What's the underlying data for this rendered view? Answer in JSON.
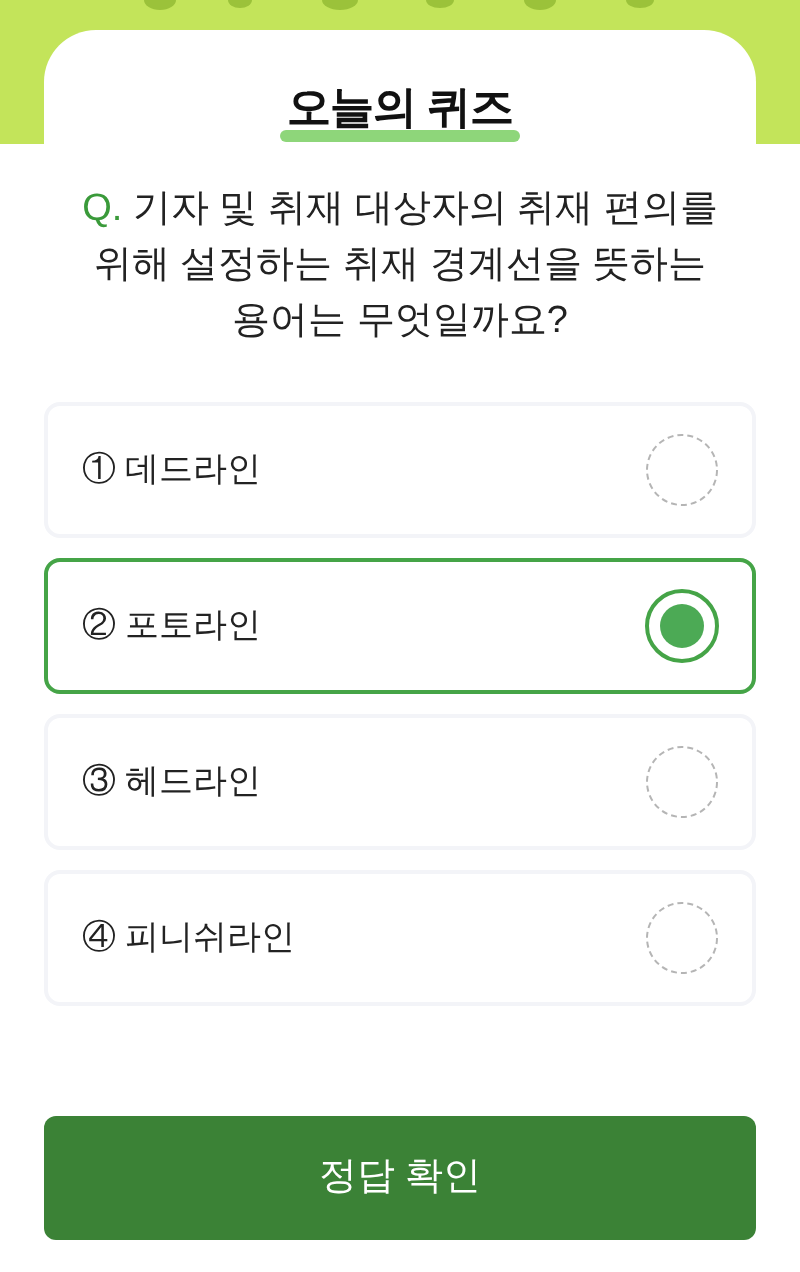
{
  "title": "오늘의 퀴즈",
  "question": {
    "mark": "Q.",
    "text": "기자 및 취재 대상자의 취재 편의를 위해 설정하는 취재 경계선을 뜻하는 용어는 무엇일까요?"
  },
  "options": [
    {
      "number": "①",
      "label": "데드라인",
      "selected": false
    },
    {
      "number": "②",
      "label": "포토라인",
      "selected": true
    },
    {
      "number": "③",
      "label": "헤드라인",
      "selected": false
    },
    {
      "number": "④",
      "label": "피니쉬라인",
      "selected": false
    }
  ],
  "submit_button": "정답 확인"
}
